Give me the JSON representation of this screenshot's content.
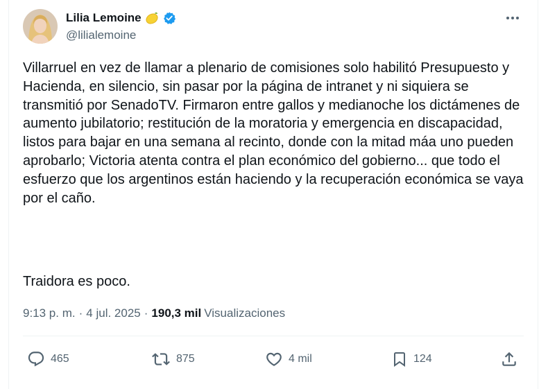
{
  "author": {
    "display_name": "Lilia Lemoine",
    "handle": "@lilialemoine",
    "emoji": "lemon-icon",
    "verified": true
  },
  "tweet": {
    "body": "Villarruel en vez de llamar a plenario de comisiones solo habilitó Presupuesto y Hacienda, en silencio, sin pasar por la página de intranet y ni siquiera se transmitió por SenadoTV. Firmaron entre gallos y medianoche los dictámenes de aumento jubilatorio; restitución de la moratoria y emergencia en discapacidad, listos para bajar en una semana al recinto, donde con la mitad máa uno pueden aprobarlo; Victoria atenta contra el plan económico del gobierno... que todo el esfuerzo que los argentinos están haciendo y la recuperación económica se vaya por el caño.",
    "closing": "Traidora es poco."
  },
  "meta": {
    "time": "9:13 p. m.",
    "date": "4 jul. 2025",
    "separator": "·",
    "views_count": "190,3 mil",
    "views_label": "Visualizaciones"
  },
  "actions": {
    "replies": "465",
    "reposts": "875",
    "likes": "4 mil",
    "bookmarks": "124"
  },
  "colors": {
    "text": "#0f1419",
    "secondary": "#536471",
    "verified": "#1d9bf0",
    "border": "#eff3f4"
  }
}
